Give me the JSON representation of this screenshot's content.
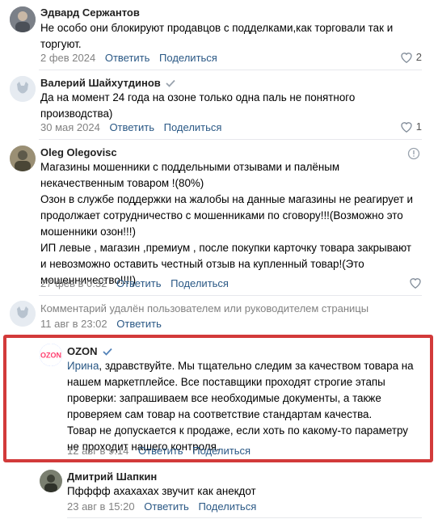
{
  "comments": [
    {
      "author": "Эдвард Сержантов",
      "verified": false,
      "lines": [
        "Не особо они блокируют продавцов с подделками,как торговали так и торгуют."
      ],
      "date": "2 фев 2024",
      "reply": "Ответить",
      "share": "Поделиться",
      "likes": "2"
    },
    {
      "author": "Валерий Шайхутдинов",
      "verified": true,
      "lines": [
        "Да на момент 24 года на озоне только одна паль не понятного производства)"
      ],
      "date": "30 мая 2024",
      "reply": "Ответить",
      "share": "Поделиться",
      "likes": "1"
    },
    {
      "author": "Oleg Olegovisc",
      "verified": false,
      "lines": [
        "Магазины мошенники с поддельными отзывами и палёным некачественным товаром !(80%)",
        "Озон в службе поддержки на жалобы на данные магазины не реагирует и продолжает сотрудничество с мошенниками по сговору!!!(Возможно это мошенники озон!!!)",
        "ИП левые , магазин ,премиум , после покупки карточку товара закрывают и невозможно оставить честный отзыв на купленный товар!(Это мошенничество!!!!)"
      ],
      "date": "27 фев в 0:32",
      "reply": "Ответить",
      "share": "Поделиться",
      "likes": ""
    },
    {
      "deleted_text": "Комментарий удалён пользователем или руководителем страницы",
      "date": "11 авг в 23:02",
      "reply": "Ответить"
    },
    {
      "author": "OZON",
      "verified": true,
      "addressee": "Ирина",
      "lines": [
        ", здравствуйте. Мы тщательно следим за качеством товара на нашем маркетплейсе. Все поставщики проходят строгие этапы проверки: запрашиваем все необходимые документы, а также проверяем сам товар на соответствие стандартам качества.",
        "Товар не допускается к продаже, если хоть по какому-то параметру не проходит нашего контроля."
      ],
      "date": "12 авг в 9:14",
      "reply": "Ответить",
      "share": "Поделиться",
      "logo_text": "OZON"
    },
    {
      "author": "Дмитрий Шапкин",
      "verified": false,
      "lines": [
        "Пфффф ахахахах звучит как анекдот"
      ],
      "date": "23 авг в 15:20",
      "reply": "Ответить",
      "share": "Поделиться"
    }
  ],
  "colors": {
    "link": "#2a5885",
    "meta": "#828282",
    "highlight_frame": "#d23a3a",
    "ozon_brand": "#005bff"
  }
}
